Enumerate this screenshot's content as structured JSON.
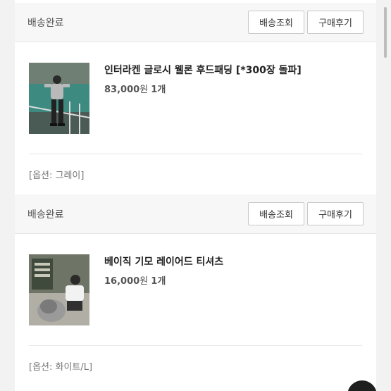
{
  "orders": [
    {
      "status": "배송완료",
      "track_button": "배송조회",
      "review_button": "구매후기",
      "product_name": "인터라켄 글로시 웰론 후드패딩 [*300장 돌파]",
      "price": "83,000",
      "currency": "원",
      "quantity": "1개",
      "option": "[옵션: 그레이]"
    },
    {
      "status": "배송완료",
      "track_button": "배송조회",
      "review_button": "구매후기",
      "product_name": "베이직 기모 레이어드 티셔츠",
      "price": "16,000",
      "currency": "원",
      "quantity": "1개",
      "option": "[옵션: 화이트/L]"
    }
  ]
}
